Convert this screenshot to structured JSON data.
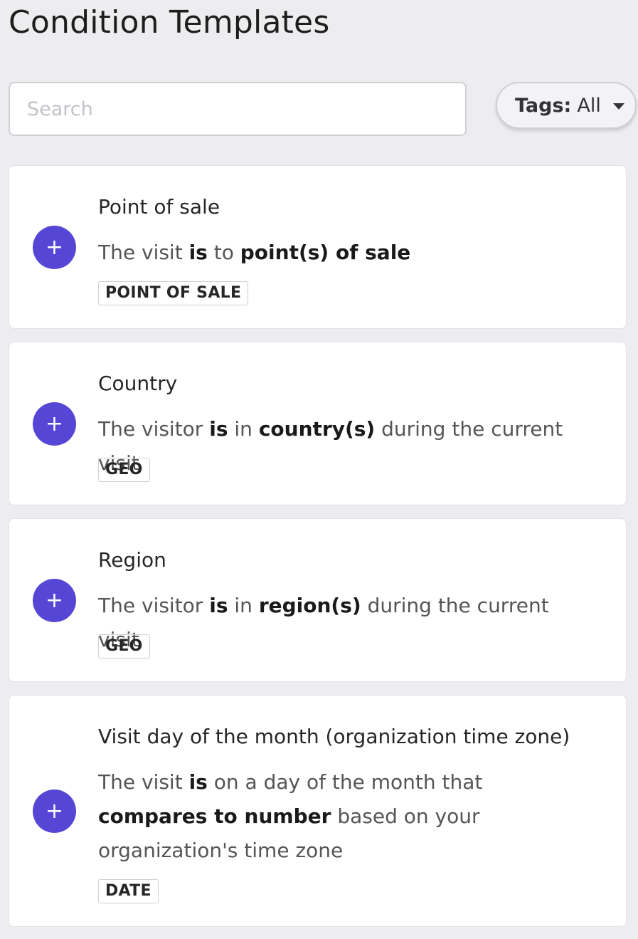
{
  "page": {
    "title": "Condition Templates"
  },
  "search": {
    "placeholder": "Search",
    "value": ""
  },
  "tags_filter": {
    "label": "Tags:",
    "value": "All"
  },
  "theme": {
    "accent": "#5546d6",
    "background": "#ededef"
  },
  "templates": [
    {
      "title": "Point of sale",
      "description": [
        {
          "text": "The visit ",
          "bold": false
        },
        {
          "text": "is",
          "bold": true
        },
        {
          "text": " to ",
          "bold": false
        },
        {
          "text": "point(s) of sale",
          "bold": true
        }
      ],
      "tag": "POINT OF SALE",
      "add_icon": "+"
    },
    {
      "title": "Country",
      "description": [
        {
          "text": "The visitor ",
          "bold": false
        },
        {
          "text": "is",
          "bold": true
        },
        {
          "text": " in ",
          "bold": false
        },
        {
          "text": "country(s)",
          "bold": true
        },
        {
          "text": " during the current visit",
          "bold": false
        }
      ],
      "tag": "GEO",
      "add_icon": "+"
    },
    {
      "title": "Region",
      "description": [
        {
          "text": "The visitor ",
          "bold": false
        },
        {
          "text": "is",
          "bold": true
        },
        {
          "text": " in ",
          "bold": false
        },
        {
          "text": "region(s)",
          "bold": true
        },
        {
          "text": " during the current visit",
          "bold": false
        }
      ],
      "tag": "GEO",
      "add_icon": "+"
    },
    {
      "title": "Visit day of the month (organization time zone)",
      "description": [
        {
          "text": "The visit ",
          "bold": false
        },
        {
          "text": "is",
          "bold": true
        },
        {
          "text": " on a day of the month that ",
          "bold": false
        },
        {
          "text": "compares to number",
          "bold": true
        },
        {
          "text": " based on your organization's time zone",
          "bold": false
        }
      ],
      "tag": "DATE",
      "add_icon": "+"
    }
  ]
}
